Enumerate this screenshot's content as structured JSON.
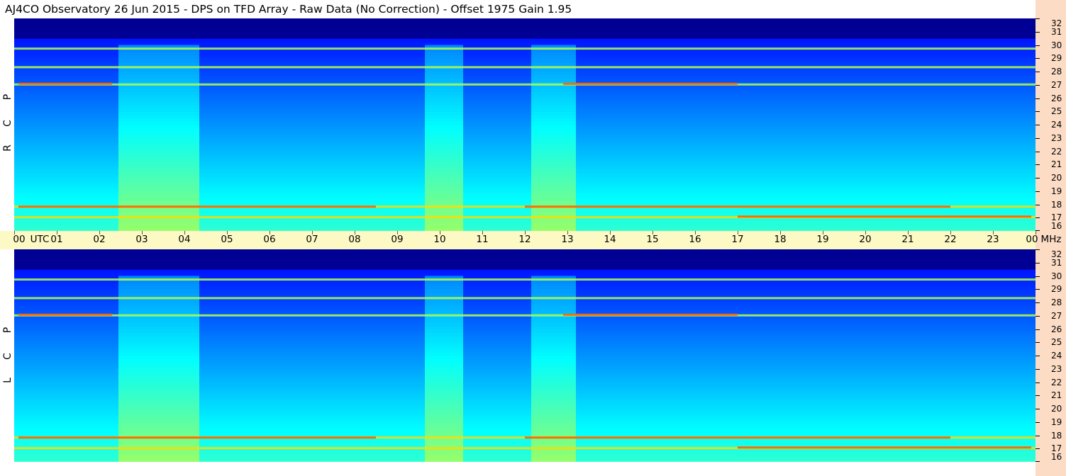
{
  "header": {
    "title": "AJ4CO Observatory  26 Jun 2015  -  DPS on TFD Array  -  Raw Data (No Correction)  -  Offset 1975  Gain 1.95"
  },
  "panels": [
    {
      "id": "rcp",
      "letters": [
        "R",
        "C",
        "P"
      ]
    },
    {
      "id": "lcp",
      "letters": [
        "L",
        "C",
        "P"
      ]
    }
  ],
  "colors": {
    "time_axis_bg": "#fdf9c4",
    "freq_axis_bg": "#fcdcc4",
    "colormap": "jet"
  },
  "chart_data": {
    "type": "heatmap",
    "x": {
      "unit": "UTC",
      "range": [
        0,
        24
      ],
      "tick_labels": [
        "00",
        "01",
        "02",
        "03",
        "04",
        "05",
        "06",
        "07",
        "08",
        "09",
        "10",
        "11",
        "12",
        "13",
        "14",
        "15",
        "16",
        "17",
        "18",
        "19",
        "20",
        "21",
        "22",
        "23",
        "00"
      ],
      "label_after_first_tick": "UTC"
    },
    "y": {
      "unit": "MHz",
      "range": [
        16,
        32
      ],
      "tick_labels": [
        "16",
        "17",
        "18",
        "19",
        "20",
        "21",
        "22",
        "23",
        "24",
        "25",
        "26",
        "27",
        "28",
        "29",
        "30",
        "31",
        "32"
      ]
    },
    "channels": [
      "RCP",
      "LCP"
    ],
    "bright_bands_mhz": [
      17.0,
      17.8,
      27.0,
      28.3,
      29.7
    ],
    "bright_vertical_bands_utc": [
      [
        2.45,
        4.35
      ],
      [
        9.65,
        10.55
      ],
      [
        12.15,
        13.2
      ]
    ],
    "dark_band_above_mhz": 30.5
  }
}
